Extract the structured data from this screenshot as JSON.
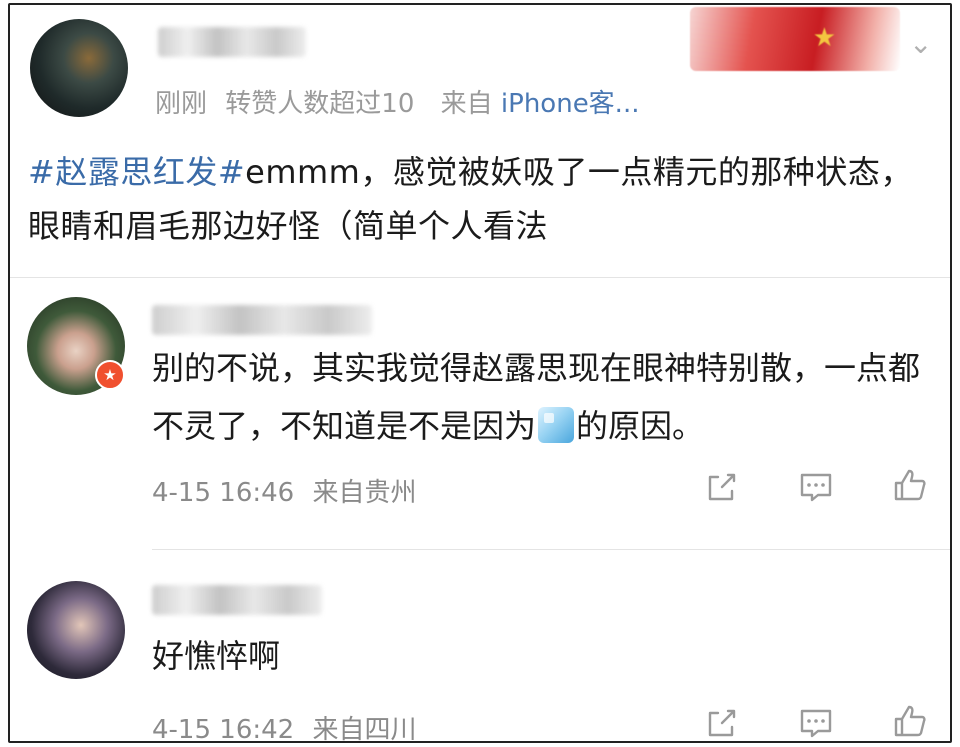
{
  "post": {
    "author": "",
    "meta_time": "刚刚",
    "meta_reposts": "转赞人数超过10",
    "meta_from": "来自",
    "meta_source": "iPhone客...",
    "hashtag": "#赵露思红发#",
    "body": "emmm，感觉被妖吸了一点精元的那种状态，眼睛和眉毛那边好怪（简单个人看法"
  },
  "comments": [
    {
      "username": "",
      "text_before_emoji": "别的不说，其实我觉得赵露思现在眼神特别散，一点都不灵了，不知道是不是因为",
      "emoji": "ice-cube-emoji",
      "text_after_emoji": "的原因。",
      "time": "4-15 16:46",
      "location": "来自贵州"
    },
    {
      "username": "",
      "text": "好憔悴啊",
      "time": "4-15 16:42",
      "location": "来自四川"
    }
  ],
  "icons": {
    "more": "chevron-down-icon",
    "share": "share-icon",
    "reply": "comment-icon",
    "like": "thumbs-up-icon"
  },
  "colors": {
    "link": "#3a6ba8",
    "meta": "#9a9a9a",
    "badge": "#f0502f"
  }
}
